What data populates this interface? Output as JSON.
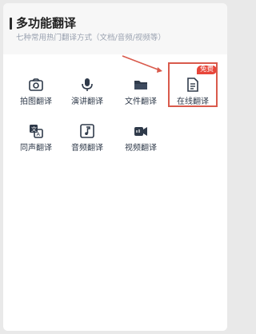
{
  "header": {
    "title": "多功能翻译",
    "subtitle": "七种常用热门翻译方式（文档/音频/视频等）"
  },
  "tools": [
    {
      "label": "拍图翻译",
      "icon": "camera-icon"
    },
    {
      "label": "演讲翻译",
      "icon": "microphone-icon"
    },
    {
      "label": "文件翻译",
      "icon": "folder-icon"
    },
    {
      "label": "在线翻译",
      "icon": "document-icon"
    },
    {
      "label": "同声翻译",
      "icon": "simultaneous-translate-icon"
    },
    {
      "label": "音频翻译",
      "icon": "music-note-icon"
    },
    {
      "label": "视频翻译",
      "icon": "video-camera-icon"
    }
  ],
  "badge": "免费",
  "colors": {
    "accent": "#e8463a",
    "highlight_border": "#d95a4c",
    "icon_stroke": "#2f3a4a"
  }
}
